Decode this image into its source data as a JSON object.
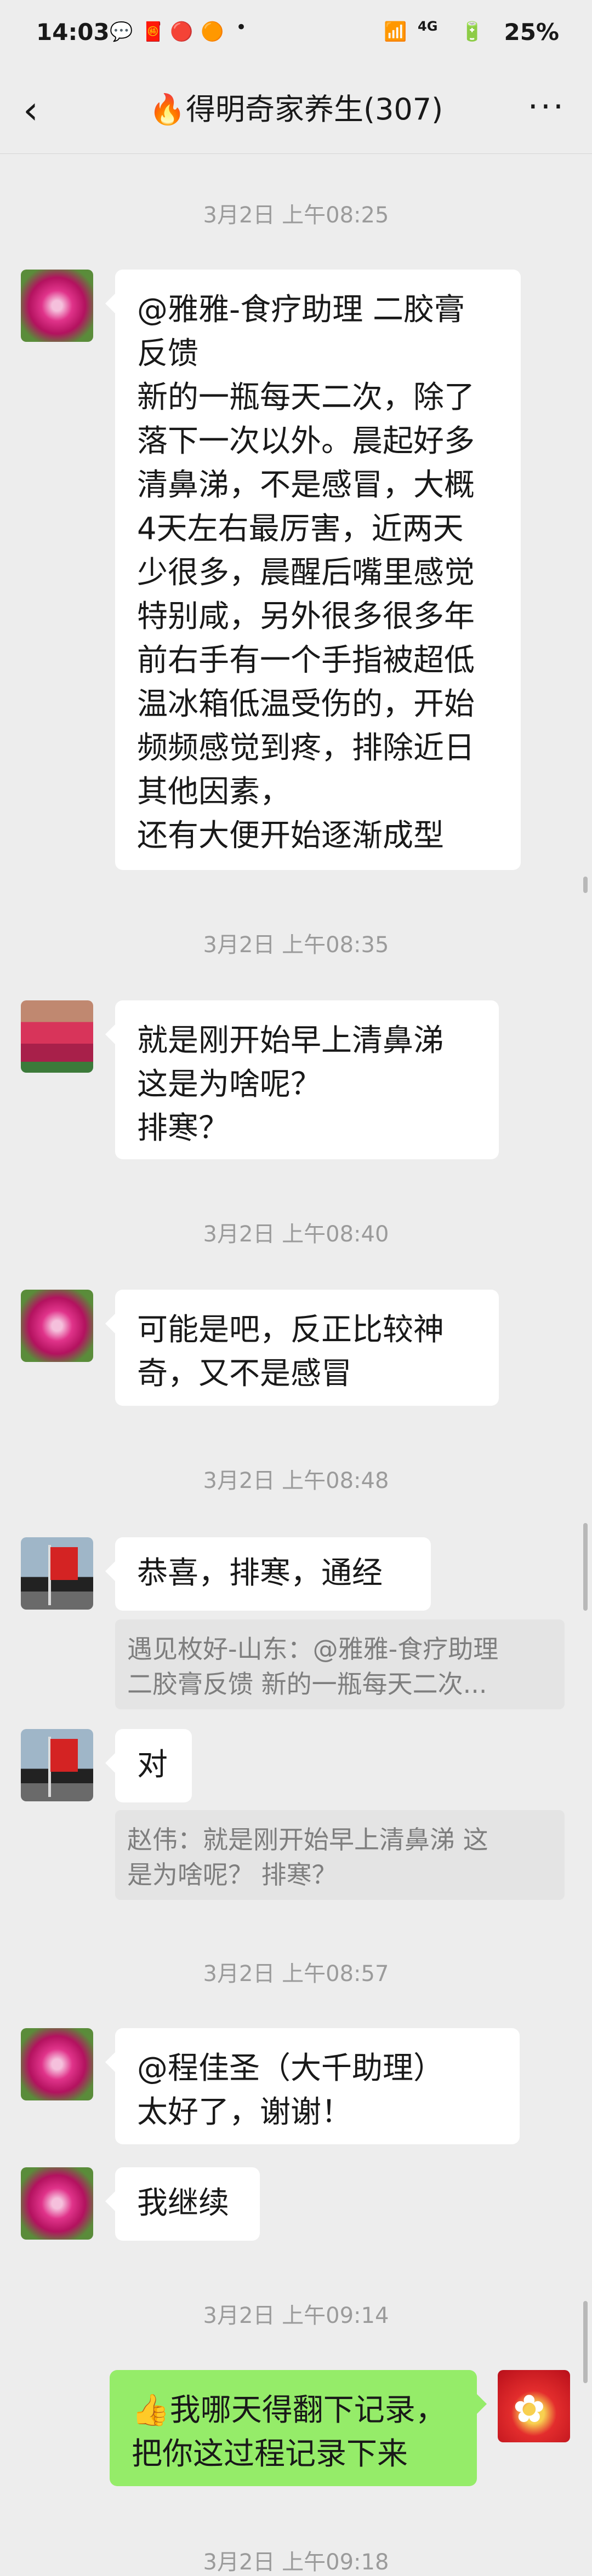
{
  "status_bar": {
    "time": "14:03",
    "battery": "25%",
    "network": "4G"
  },
  "header": {
    "title": "🔥得明奇家养生(307)",
    "back_icon": "chevron-left-icon",
    "more_icon": "more-dots-icon"
  },
  "timestamps": [
    "3月2日 上午08:25",
    "3月2日 上午08:35",
    "3月2日 上午08:40",
    "3月2日 上午08:48",
    "3月2日 上午08:57",
    "3月2日 上午09:14",
    "3月2日 上午09:18"
  ],
  "messages": [
    {
      "text": "@雅雅-食疗助理  二胶膏\n反馈\n新的一瓶每天二次，除了\n落下一次以外。晨起好多\n清鼻涕，不是感冒，大概\n4天左右最厉害，近两天\n少很多，晨醒后嘴里感觉\n特别咸，另外很多很多年\n前右手有一个手指被超低\n温冰箱低温受伤的，开始\n频频感觉到疼，排除近日\n其他因素，\n还有大便开始逐渐成型"
    },
    {
      "text": "就是刚开始早上清鼻涕\n这是为啥呢？\n排寒？"
    },
    {
      "text": "可能是吧，反正比较神\n奇，又不是感冒"
    },
    {
      "text": "恭喜，排寒，通经",
      "quote": "遇见枚好-山东：@雅雅-食疗助理\n二胶膏反馈 新的一瓶每天二次..."
    },
    {
      "text": "对",
      "quote": "赵伟：就是刚开始早上清鼻涕 这\n是为啥呢？ 排寒？"
    },
    {
      "text": "@程佳圣（大千助理）\n太好了，谢谢！"
    },
    {
      "text": "我继续"
    },
    {
      "text": "👍我哪天得翻下记录，\n把你这过程记录下来"
    }
  ],
  "colors": {
    "background": "#ededed",
    "bubble_left": "#ffffff",
    "bubble_me": "#95ec69",
    "timestamp": "#9b9b9b"
  }
}
